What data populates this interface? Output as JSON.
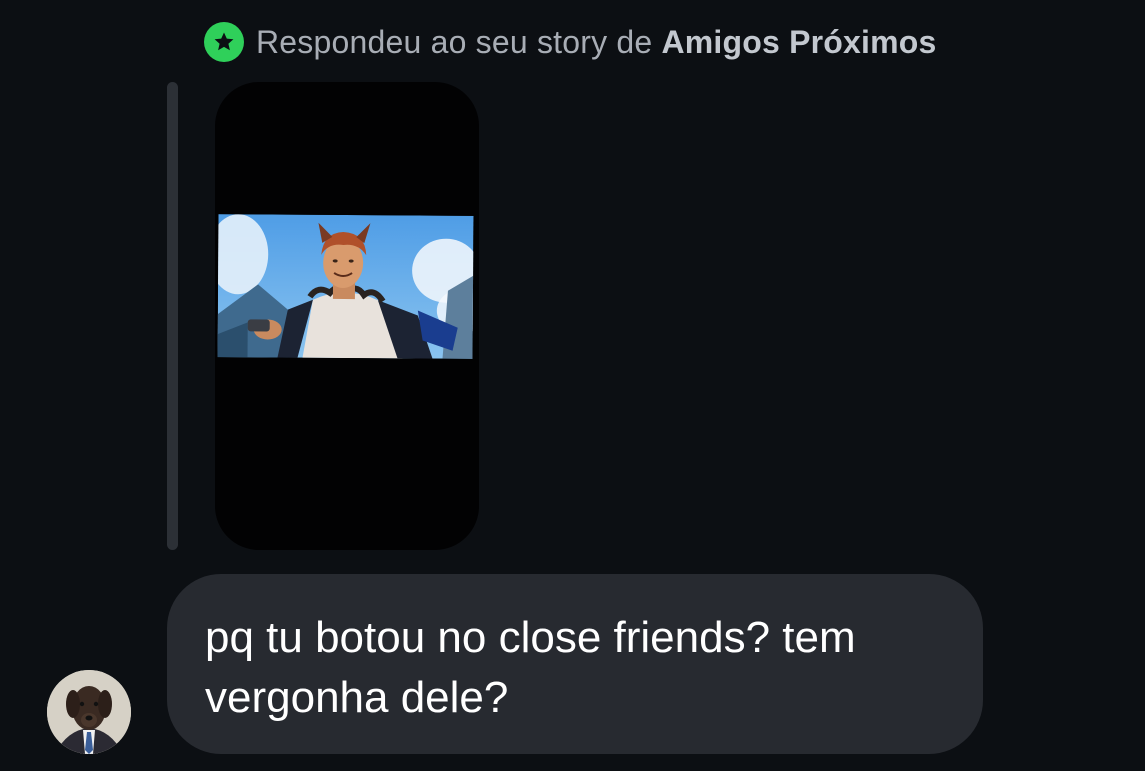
{
  "reply_header": {
    "icon": "star-icon",
    "badge_color": "#2fd05a",
    "prefix": "Respondeu ao seu story de ",
    "audience": "Amigos Próximos"
  },
  "story": {
    "image_subject": "animated-character-with-wolf-ears"
  },
  "message": {
    "line1": "pq tu botou no close friends? tem",
    "line2": "vergonha dele?"
  },
  "sender": {
    "avatar": "dog-in-suit-avatar"
  },
  "colors": {
    "background": "#0c0f13",
    "bubble": "#272a30",
    "quote_bar": "#2c3036"
  }
}
